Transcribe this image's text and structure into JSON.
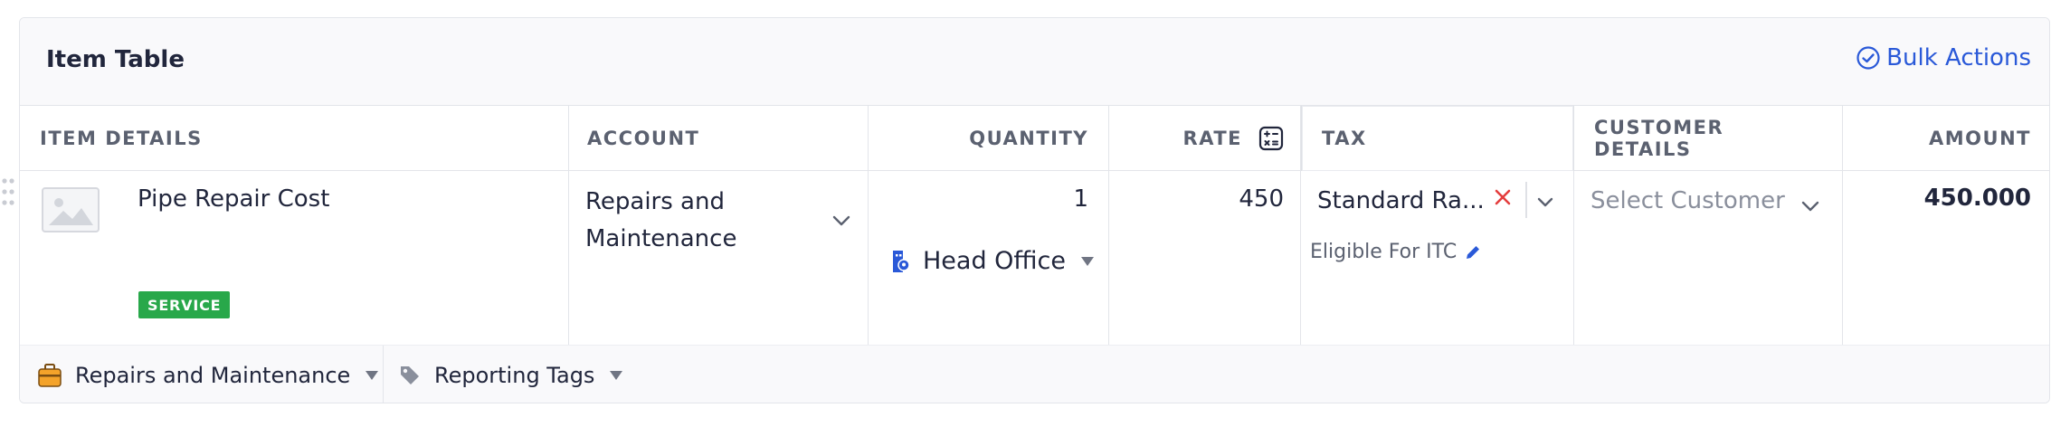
{
  "header": {
    "title": "Item Table",
    "bulk_actions_label": "Bulk Actions",
    "accent_color": "#2a59d8"
  },
  "columns": {
    "item_details": "ITEM DETAILS",
    "account": "ACCOUNT",
    "quantity": "QUANTITY",
    "rate": "RATE",
    "tax": "TAX",
    "customer_details": "CUSTOMER DETAILS",
    "amount": "AMOUNT"
  },
  "row": {
    "item_name": "Pipe Repair Cost",
    "item_type_badge": "SERVICE",
    "badge_color": "#28a84a",
    "account": "Repairs and Maintenance",
    "quantity": "1",
    "location": "Head Office",
    "rate": "450",
    "tax": "Standard Ra...",
    "tax_note": "Eligible For ITC",
    "customer_placeholder": "Select Customer",
    "amount": "450.000"
  },
  "footer": {
    "account_tag": "Repairs and Maintenance",
    "reporting_tags": "Reporting Tags"
  },
  "icons": {
    "bulk_actions": "check-circle-icon",
    "rate": "calculator-icon",
    "location": "location-icon",
    "tax_clear": "close-icon",
    "tax_edit": "pencil-icon",
    "footer_account": "briefcase-icon",
    "footer_tags": "tag-icon"
  }
}
